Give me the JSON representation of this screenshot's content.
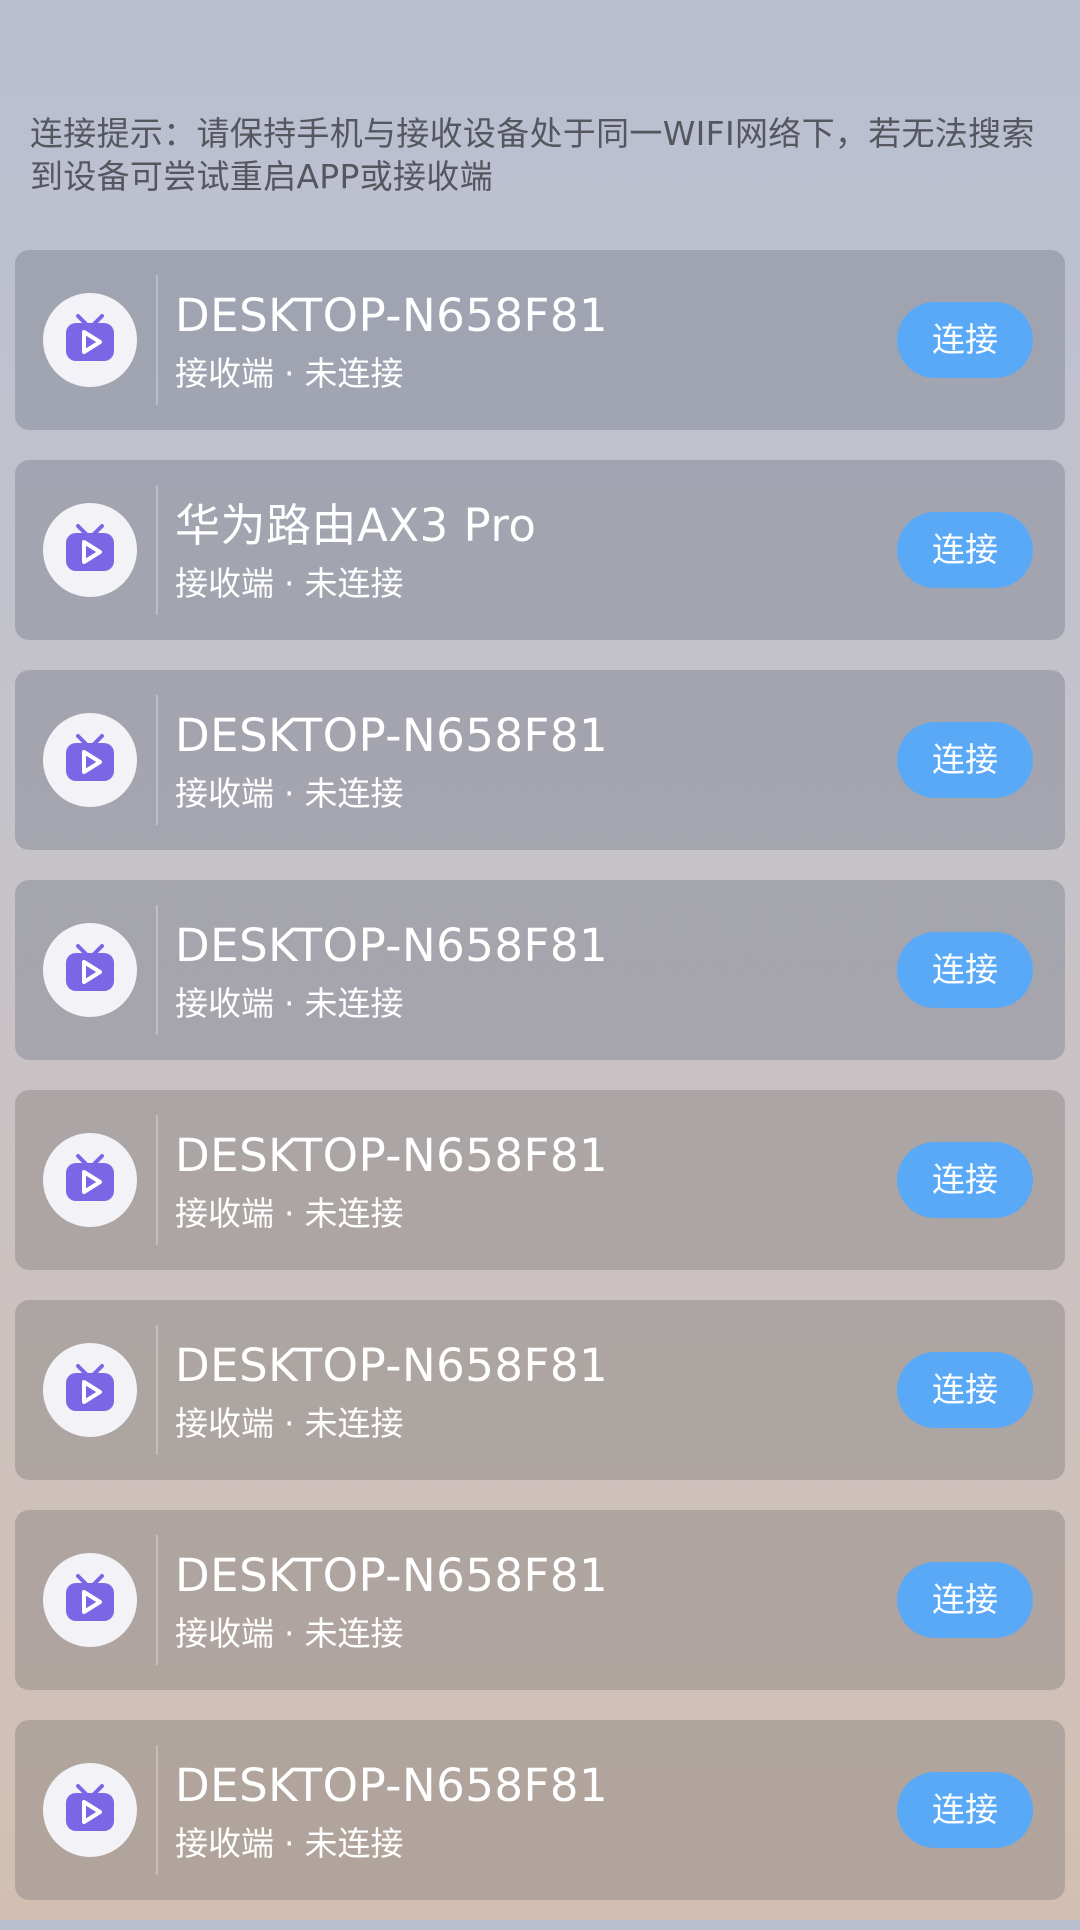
{
  "hint": {
    "text": "连接提示：请保持手机与接收设备处于同一WIFI网络下，若无法搜索到设备可尝试重启APP或接收端"
  },
  "colors": {
    "accent": "#5aa9f7",
    "icon_purple": "#7b67e6"
  },
  "devices": [
    {
      "name": "DESKTOP-N658F81",
      "type": "接收端",
      "separator": "·",
      "status": "未连接",
      "button": "连接",
      "icon": "tv-play-icon"
    },
    {
      "name": "华为路由AX3 Pro",
      "type": "接收端",
      "separator": "·",
      "status": "未连接",
      "button": "连接",
      "icon": "tv-play-icon"
    },
    {
      "name": "DESKTOP-N658F81",
      "type": "接收端",
      "separator": "·",
      "status": "未连接",
      "button": "连接",
      "icon": "tv-play-icon"
    },
    {
      "name": "DESKTOP-N658F81",
      "type": "接收端",
      "separator": "·",
      "status": "未连接",
      "button": "连接",
      "icon": "tv-play-icon"
    },
    {
      "name": "DESKTOP-N658F81",
      "type": "接收端",
      "separator": "·",
      "status": "未连接",
      "button": "连接",
      "icon": "tv-play-icon"
    },
    {
      "name": "DESKTOP-N658F81",
      "type": "接收端",
      "separator": "·",
      "status": "未连接",
      "button": "连接",
      "icon": "tv-play-icon"
    },
    {
      "name": "DESKTOP-N658F81",
      "type": "接收端",
      "separator": "·",
      "status": "未连接",
      "button": "连接",
      "icon": "tv-play-icon"
    },
    {
      "name": "DESKTOP-N658F81",
      "type": "接收端",
      "separator": "·",
      "status": "未连接",
      "button": "连接",
      "icon": "tv-play-icon"
    }
  ]
}
